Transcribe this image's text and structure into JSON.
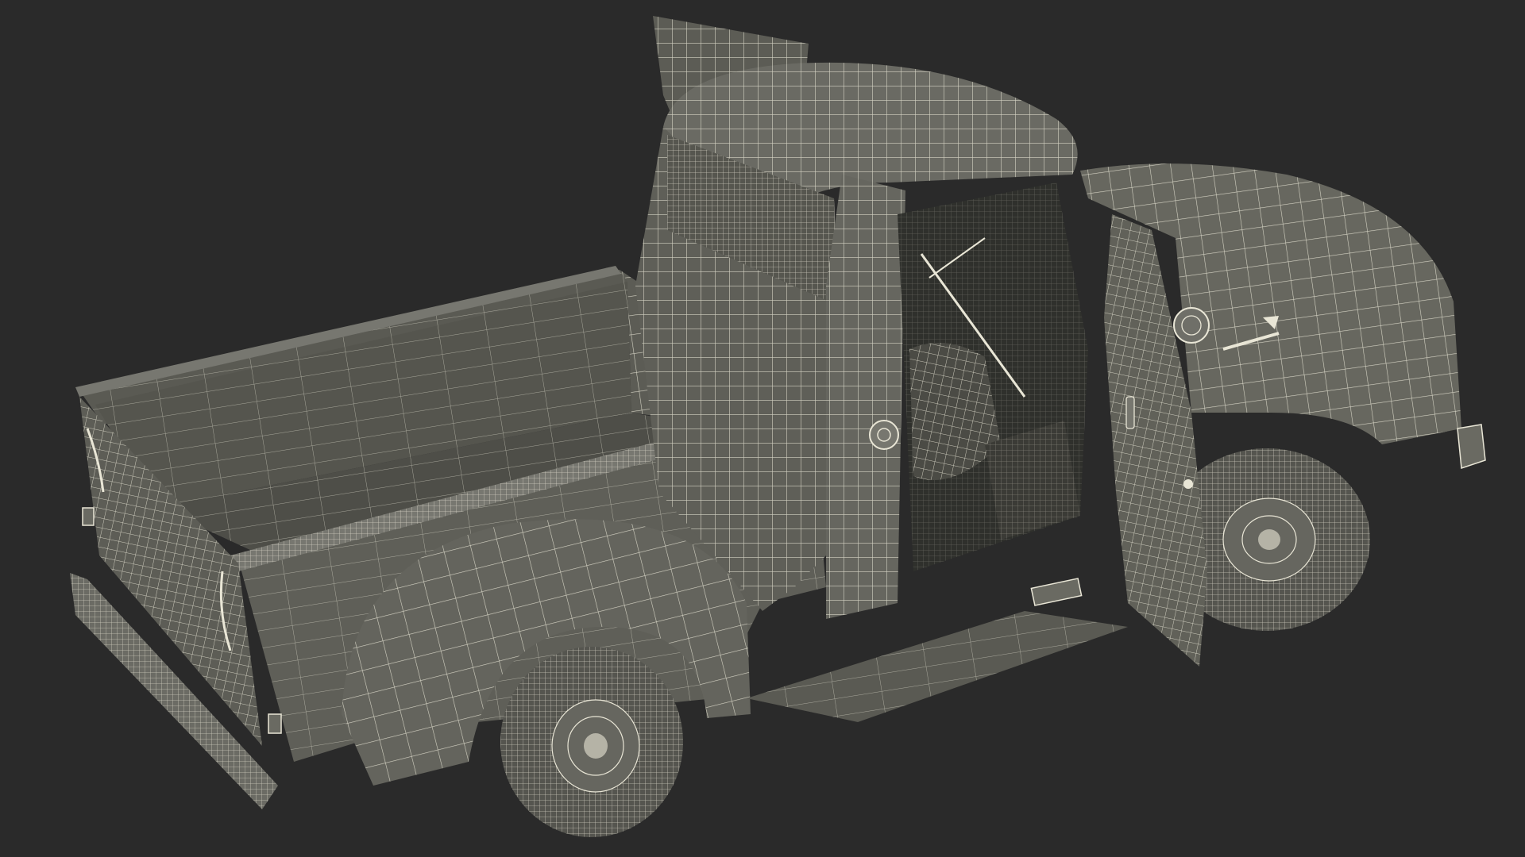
{
  "scene": {
    "subject": "pickup-truck-wireframe",
    "view": "rear-three-quarter-top",
    "doors_open": true
  },
  "colors": {
    "background": "#2a2a2a",
    "body_shade": "#5e5e58",
    "body_light": "#6f6f68",
    "body_dark": "#46463f",
    "wire": "#e9e6d6",
    "interior": "#2f302c",
    "tire": "#53534d"
  },
  "icons": {
    "fuel_cap": "fuel-cap-icon",
    "hood_emblem": "hood-emblem-icon",
    "tail_light": "tail-light-icon",
    "door_handle": "door-handle-icon"
  }
}
